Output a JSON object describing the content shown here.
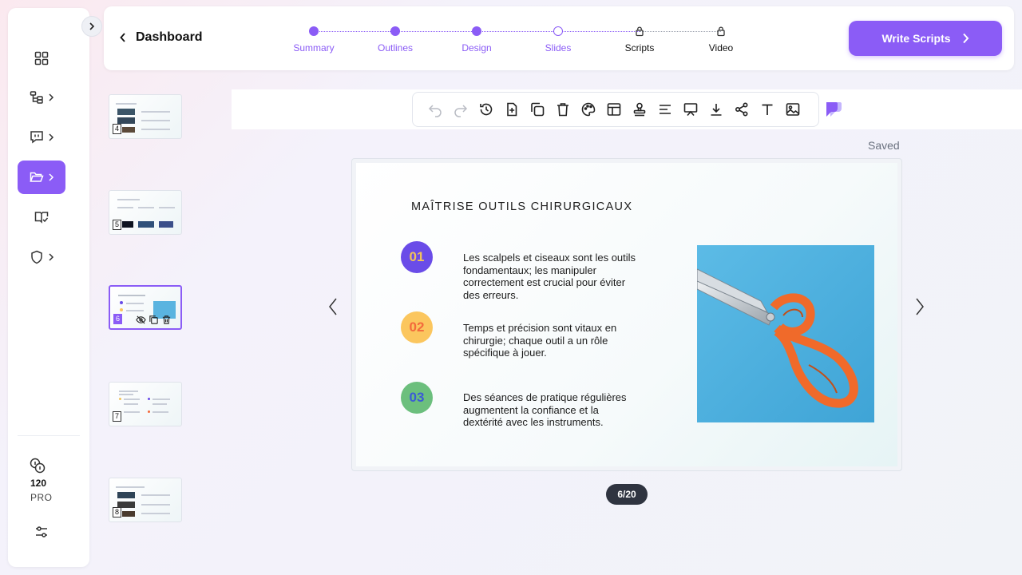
{
  "header": {
    "back_label": "Dashboard",
    "steps": [
      {
        "label": "Summary",
        "state": "done"
      },
      {
        "label": "Outlines",
        "state": "done"
      },
      {
        "label": "Design",
        "state": "done"
      },
      {
        "label": "Slides",
        "state": "current"
      },
      {
        "label": "Scripts",
        "state": "locked"
      },
      {
        "label": "Video",
        "state": "locked"
      }
    ],
    "cta_label": "Write Scripts"
  },
  "sidebar": {
    "items": [
      {
        "icon": "grid-icon"
      },
      {
        "icon": "tree-icon"
      },
      {
        "icon": "chat-icon"
      },
      {
        "icon": "folder-open-icon"
      },
      {
        "icon": "book-check-icon"
      },
      {
        "icon": "shield-icon"
      }
    ],
    "credits": "120",
    "plan": "PRO"
  },
  "thumbnails": [
    {
      "number": "4"
    },
    {
      "number": "5"
    },
    {
      "number": "6"
    },
    {
      "number": "7"
    },
    {
      "number": "8"
    }
  ],
  "toolbar": {
    "status": "Saved",
    "tools": [
      "undo-icon",
      "redo-icon",
      "history-icon",
      "add-slide-icon",
      "duplicate-icon",
      "delete-icon",
      "palette-icon",
      "layout-icon",
      "stamp-icon",
      "align-icon",
      "present-icon",
      "download-icon",
      "share-icon",
      "text-icon",
      "image-icon"
    ]
  },
  "slide": {
    "title": "MAÎTRISE OUTILS CHIRURGICAUX",
    "points": [
      {
        "number": "01",
        "text": "Les scalpels et ciseaux sont les outils fondamentaux; les manipuler correctement est crucial pour éviter des erreurs.",
        "circle_color": "#6a4ce8",
        "number_color": "#f2c35a"
      },
      {
        "number": "02",
        "text": "Temps et précision sont vitaux en chirurgie; chaque outil a un rôle spécifique à jouer.",
        "circle_color": "#fbc65e",
        "number_color": "#f36a3c"
      },
      {
        "number": "03",
        "text": "Des séances de pratique régulières augmentent la confiance et la dextérité avec les instruments.",
        "circle_color": "#6cbf7d",
        "number_color": "#3b5bd6"
      }
    ]
  },
  "pagination": "6/20",
  "colors": {
    "accent": "#8b5cf6"
  }
}
